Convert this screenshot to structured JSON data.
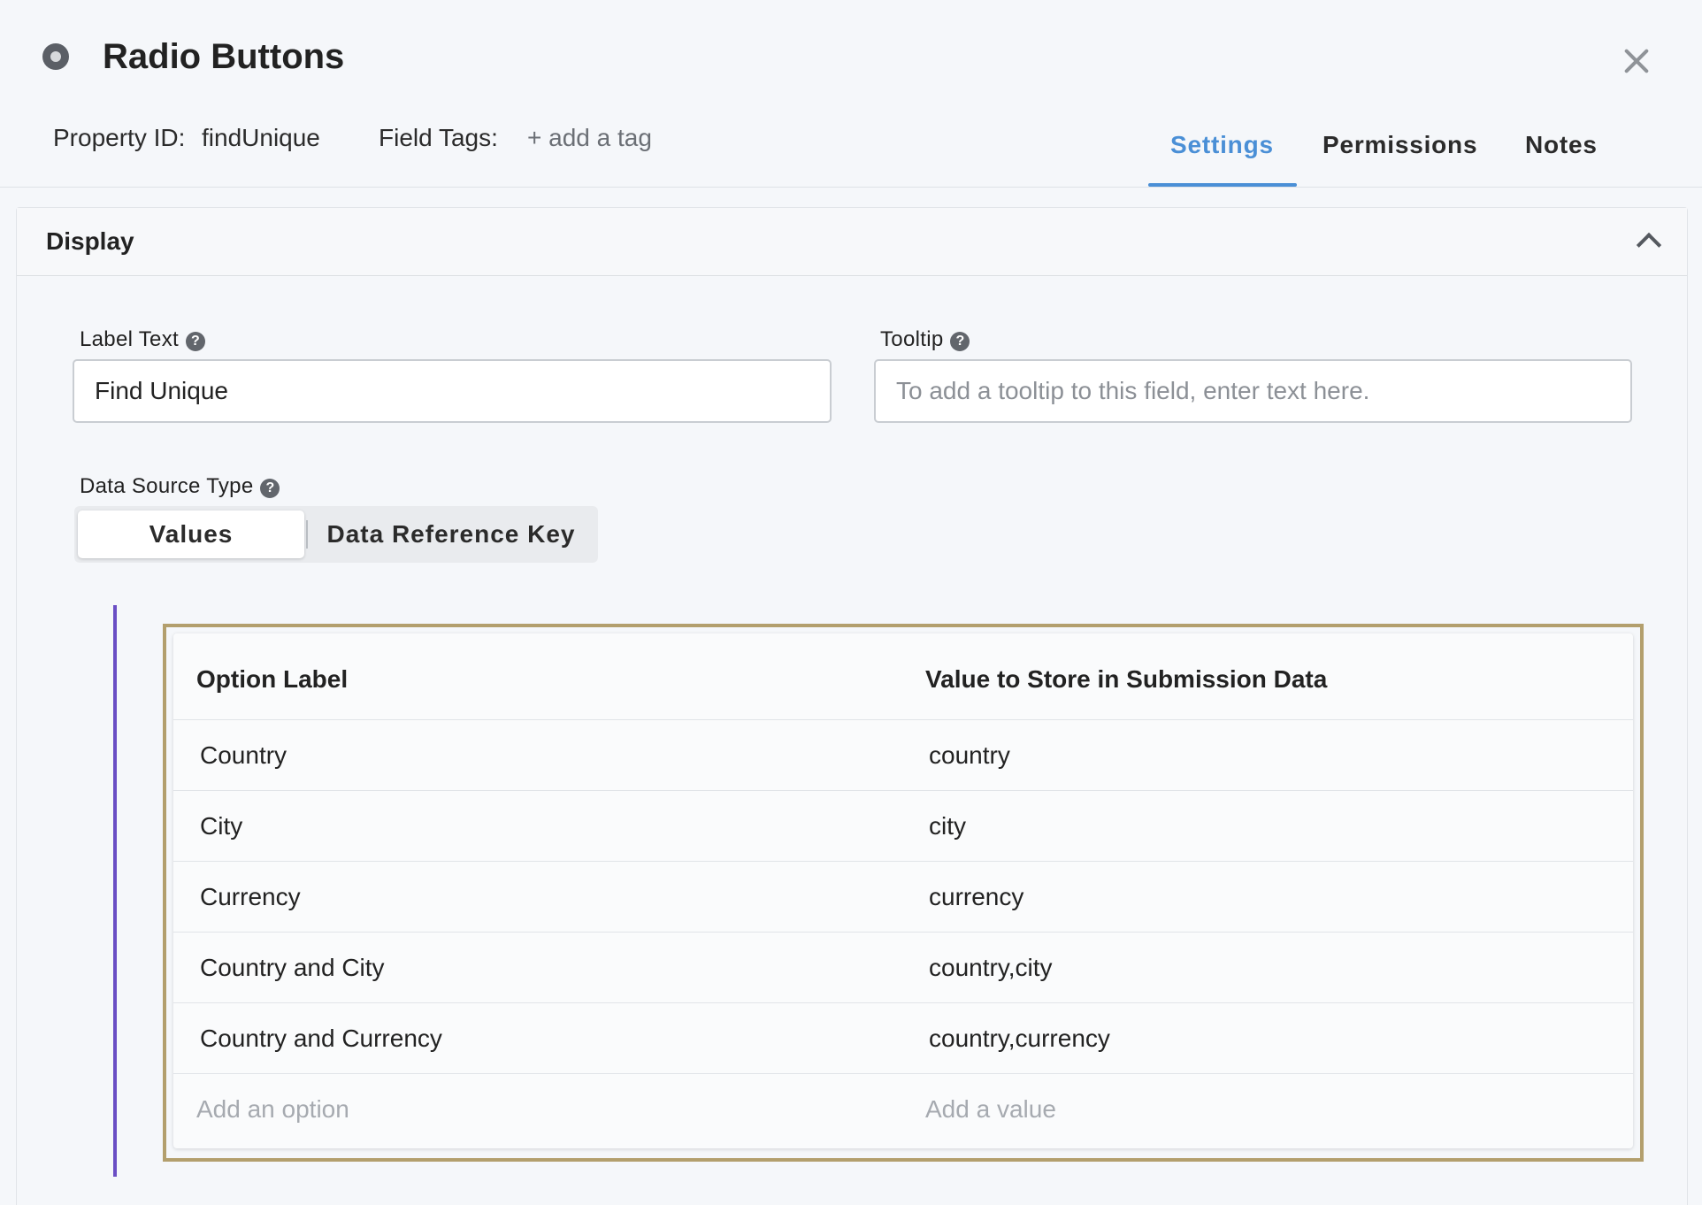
{
  "modal": {
    "title": "Radio Buttons",
    "icon": "radio-button-icon"
  },
  "meta": {
    "property_id_label": "Property ID:",
    "property_id_value": "findUnique",
    "field_tags_label": "Field Tags:",
    "add_tag_label": "+ add a tag"
  },
  "tabs": [
    {
      "label": "Settings",
      "active": true
    },
    {
      "label": "Permissions",
      "active": false
    },
    {
      "label": "Notes",
      "active": false
    }
  ],
  "section": {
    "title": "Display"
  },
  "label_text": {
    "label": "Label Text",
    "value": "Find Unique"
  },
  "tooltip": {
    "label": "Tooltip",
    "placeholder": "To add a tooltip to this field, enter text here."
  },
  "data_source": {
    "label": "Data Source Type",
    "options": [
      "Values",
      "Data Reference Key"
    ],
    "selected": "Values"
  },
  "options_table": {
    "headers": {
      "label": "Option Label",
      "value": "Value to Store in Submission Data"
    },
    "rows": [
      {
        "label": "Country",
        "value": "country"
      },
      {
        "label": "City",
        "value": "city"
      },
      {
        "label": "Currency",
        "value": "currency"
      },
      {
        "label": "Country and City",
        "value": "country,city"
      },
      {
        "label": "Country and Currency",
        "value": "country,currency"
      }
    ],
    "add_option_placeholder": "Add an option",
    "add_value_placeholder": "Add a value"
  },
  "colors": {
    "accent": "#4a8fd6",
    "highlight_border": "#b39f6d",
    "left_rule": "#6a4ec4"
  }
}
